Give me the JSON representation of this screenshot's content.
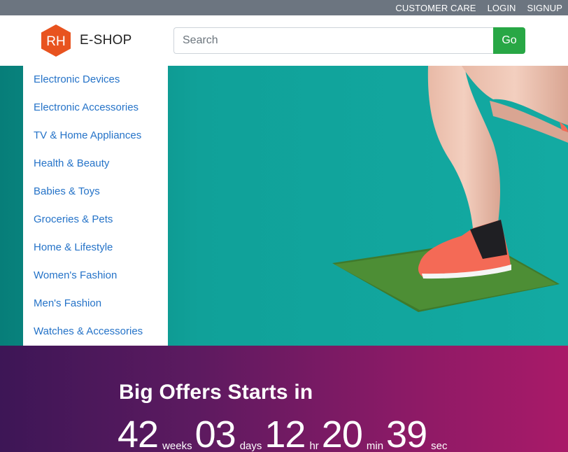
{
  "topbar": {
    "links": [
      "CUSTOMER CARE",
      "LOGIN",
      "SIGNUP"
    ]
  },
  "header": {
    "logo_text": "RH",
    "brand": "E-SHOP",
    "search_placeholder": "Search",
    "search_value": "",
    "go_label": "Go"
  },
  "categories": [
    "Electronic Devices",
    "Electronic Accessories",
    "TV & Home Appliances",
    "Health & Beauty",
    "Babies & Toys",
    "Groceries & Pets",
    "Home & Lifestyle",
    "Women's Fashion",
    "Men's Fashion",
    "Watches & Accessories"
  ],
  "offers": {
    "title": "Big Offers Starts in",
    "countdown": [
      {
        "value": "42",
        "unit": "weeks"
      },
      {
        "value": "03",
        "unit": "days"
      },
      {
        "value": "12",
        "unit": "hr"
      },
      {
        "value": "20",
        "unit": "min"
      },
      {
        "value": "39",
        "unit": "sec"
      }
    ]
  },
  "colors": {
    "topbar": "#6c7580",
    "accent_logo": "#e8531f",
    "go_button": "#28a745",
    "category_link": "#2573c8",
    "hero_bg": "#12a79f"
  }
}
